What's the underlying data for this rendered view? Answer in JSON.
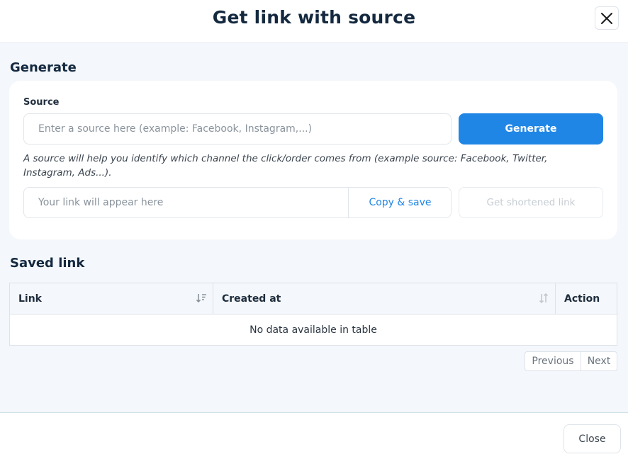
{
  "modal": {
    "title": "Get link with source",
    "close_icon": "close-icon"
  },
  "generate": {
    "section_title": "Generate",
    "source_label": "Source",
    "source_placeholder": "Enter a source here (example: Facebook, Instagram,...)",
    "generate_button": "Generate",
    "hint": "A source will help you identify which channel the click/order comes from (example source: Facebook, Twitter, Instagram, Ads...).",
    "link_placeholder": "Your link will appear here",
    "copy_button": "Copy & save",
    "shortened_button": "Get shortened link"
  },
  "saved": {
    "section_title": "Saved link",
    "columns": [
      "Link",
      "Created at",
      "Action"
    ],
    "empty_message": "No data available in table",
    "sort_icons": [
      "sort-descending-icon",
      "sort-icon"
    ],
    "previous": "Previous",
    "next": "Next"
  },
  "footer": {
    "close_button": "Close"
  },
  "colors": {
    "primary": "#1f86e6",
    "title": "#14293f",
    "body_bg": "#f4f7fb"
  }
}
